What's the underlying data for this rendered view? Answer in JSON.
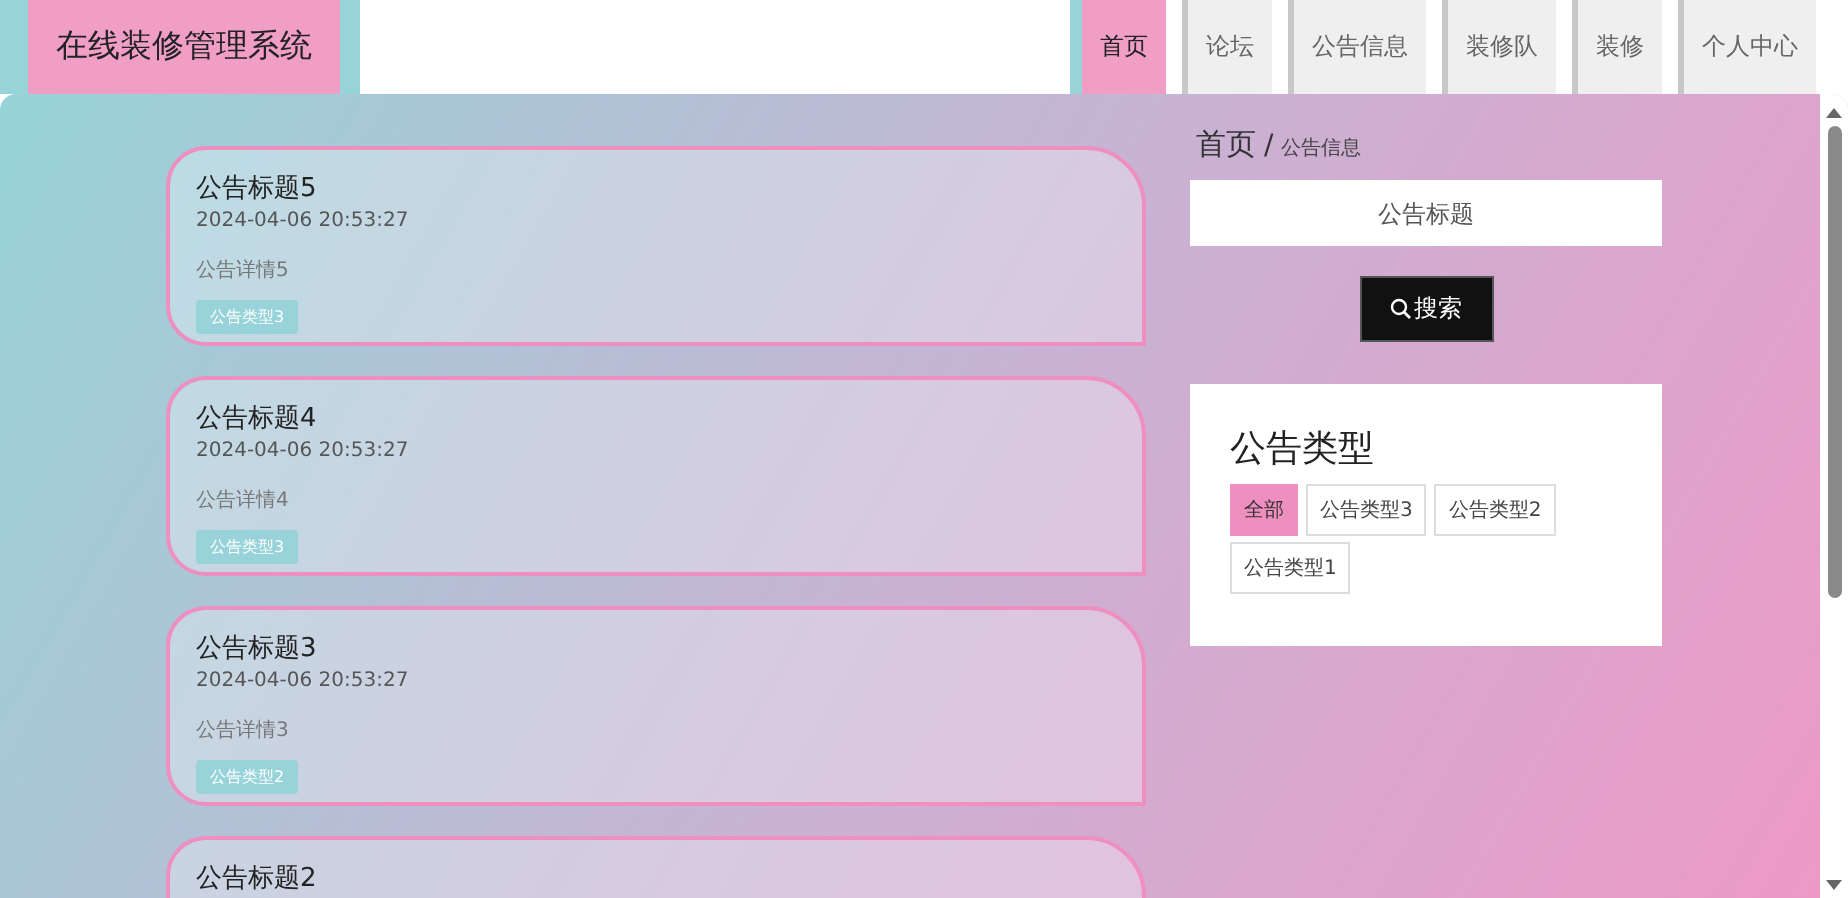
{
  "site_title": "在线装修管理系统",
  "nav": [
    {
      "label": "首页",
      "selected": true
    },
    {
      "label": "论坛",
      "selected": false
    },
    {
      "label": "公告信息",
      "selected": false
    },
    {
      "label": "装修队",
      "selected": false
    },
    {
      "label": "装修",
      "selected": false
    },
    {
      "label": "个人中心",
      "selected": false
    }
  ],
  "notices": [
    {
      "title": "公告标题5",
      "time": "2024-04-06 20:53:27",
      "detail": "公告详情5",
      "tag": "公告类型3"
    },
    {
      "title": "公告标题4",
      "time": "2024-04-06 20:53:27",
      "detail": "公告详情4",
      "tag": "公告类型3"
    },
    {
      "title": "公告标题3",
      "time": "2024-04-06 20:53:27",
      "detail": "公告详情3",
      "tag": "公告类型2"
    },
    {
      "title": "公告标题2"
    }
  ],
  "breadcrumb": {
    "home": "首页",
    "separator": "/",
    "current": "公告信息"
  },
  "search": {
    "placeholder": "公告标题",
    "button": "搜索"
  },
  "types": {
    "heading": "公告类型",
    "items": [
      {
        "label": "全部",
        "selected": true
      },
      {
        "label": "公告类型3",
        "selected": false
      },
      {
        "label": "公告类型2",
        "selected": false
      },
      {
        "label": "公告类型1",
        "selected": false
      }
    ]
  }
}
